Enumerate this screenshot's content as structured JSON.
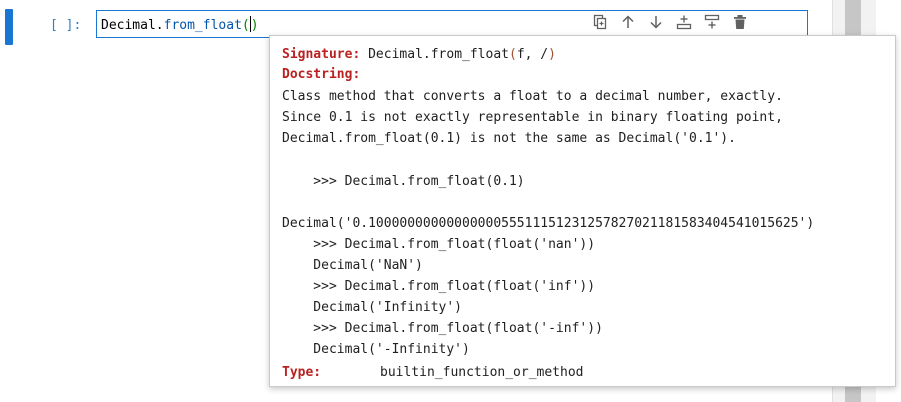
{
  "cell": {
    "prompt": "[ ]:",
    "code": {
      "object": "Decimal",
      "dot": ".",
      "method": "from_float",
      "open_paren": "(",
      "close_paren": ")"
    }
  },
  "toolbar": {
    "buttons": [
      {
        "name": "duplicate-cell",
        "icon": "copy-icon"
      },
      {
        "name": "move-up",
        "icon": "arrow-up-icon"
      },
      {
        "name": "move-down",
        "icon": "arrow-down-icon"
      },
      {
        "name": "insert-above",
        "icon": "insert-above-icon"
      },
      {
        "name": "insert-below",
        "icon": "insert-below-icon"
      },
      {
        "name": "delete-cell",
        "icon": "trash-icon"
      }
    ]
  },
  "tooltip": {
    "signature_label": "Signature:",
    "signature_name": "Decimal.from_float",
    "signature_open": "(",
    "signature_args": "f, /",
    "signature_close": ")",
    "docstring_label": "Docstring:",
    "lines": [
      "Class method that converts a float to a decimal number, exactly.",
      "Since 0.1 is not exactly representable in binary floating point,",
      "Decimal.from_float(0.1) is not the same as Decimal('0.1').",
      "",
      "    >>> Decimal.from_float(0.1)",
      "",
      "Decimal('0.1000000000000000055511151231257827021181583404541015625')",
      "    >>> Decimal.from_float(float('nan'))",
      "    Decimal('NaN')",
      "    >>> Decimal.from_float(float('inf'))",
      "    Decimal('Infinity')",
      "    >>> Decimal.from_float(float('-inf'))",
      "    Decimal('-Infinity')"
    ],
    "type_label": "Type:",
    "type_value": "builtin_function_or_method"
  },
  "colors": {
    "accent": "#1976d2",
    "keyword": "#ba2121",
    "argument": "#a0522d",
    "prompt": "#307fc1"
  }
}
